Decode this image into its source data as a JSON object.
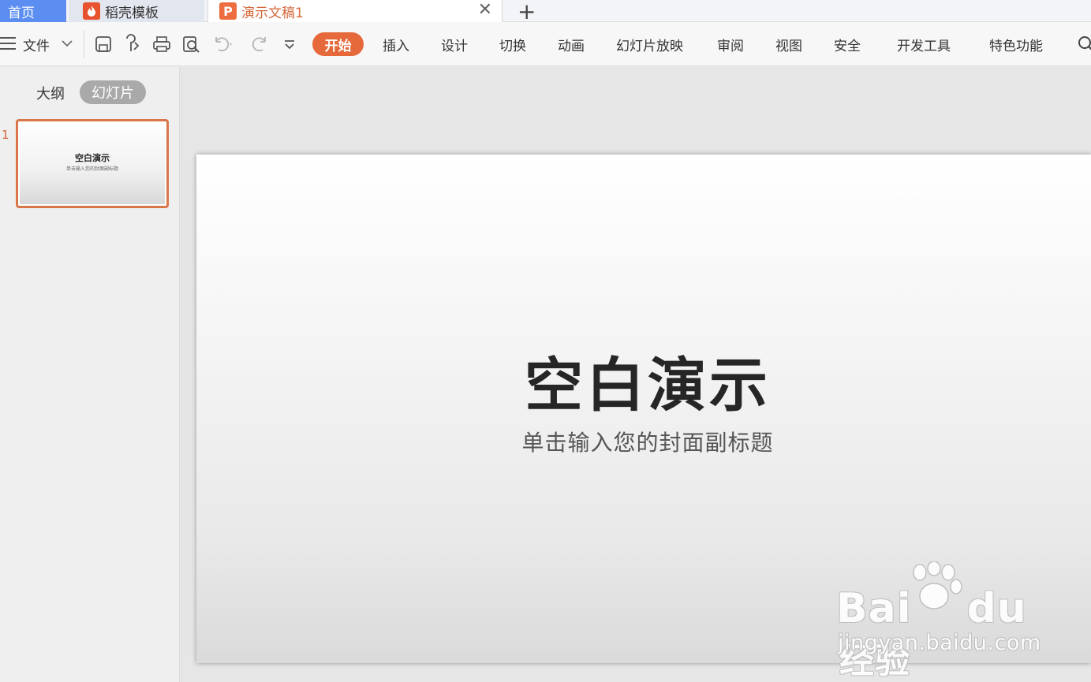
{
  "tabs": {
    "home": "首页",
    "templates": "稻壳模板",
    "document": "演示文稿1"
  },
  "menu": {
    "file": "文件",
    "items": [
      "开始",
      "插入",
      "设计",
      "切换",
      "动画",
      "幻灯片放映",
      "审阅",
      "视图",
      "安全",
      "开发工具",
      "特色功能"
    ],
    "active": "开始"
  },
  "panel": {
    "outline_tab": "大纲",
    "slides_tab": "幻灯片",
    "slide_number": "1",
    "thumb_title": "空白演示",
    "thumb_subtitle": "单击输入您的封面副标题"
  },
  "slide": {
    "title": "空白演示",
    "subtitle": "单击输入您的封面副标题"
  },
  "watermark": {
    "brand": "Bai",
    "brand2": "du",
    "brand_cn": "经验",
    "url": "jingyan.baidu.com"
  },
  "colors": {
    "accent": "#e5693a",
    "home_tab": "#5b8ef0"
  }
}
